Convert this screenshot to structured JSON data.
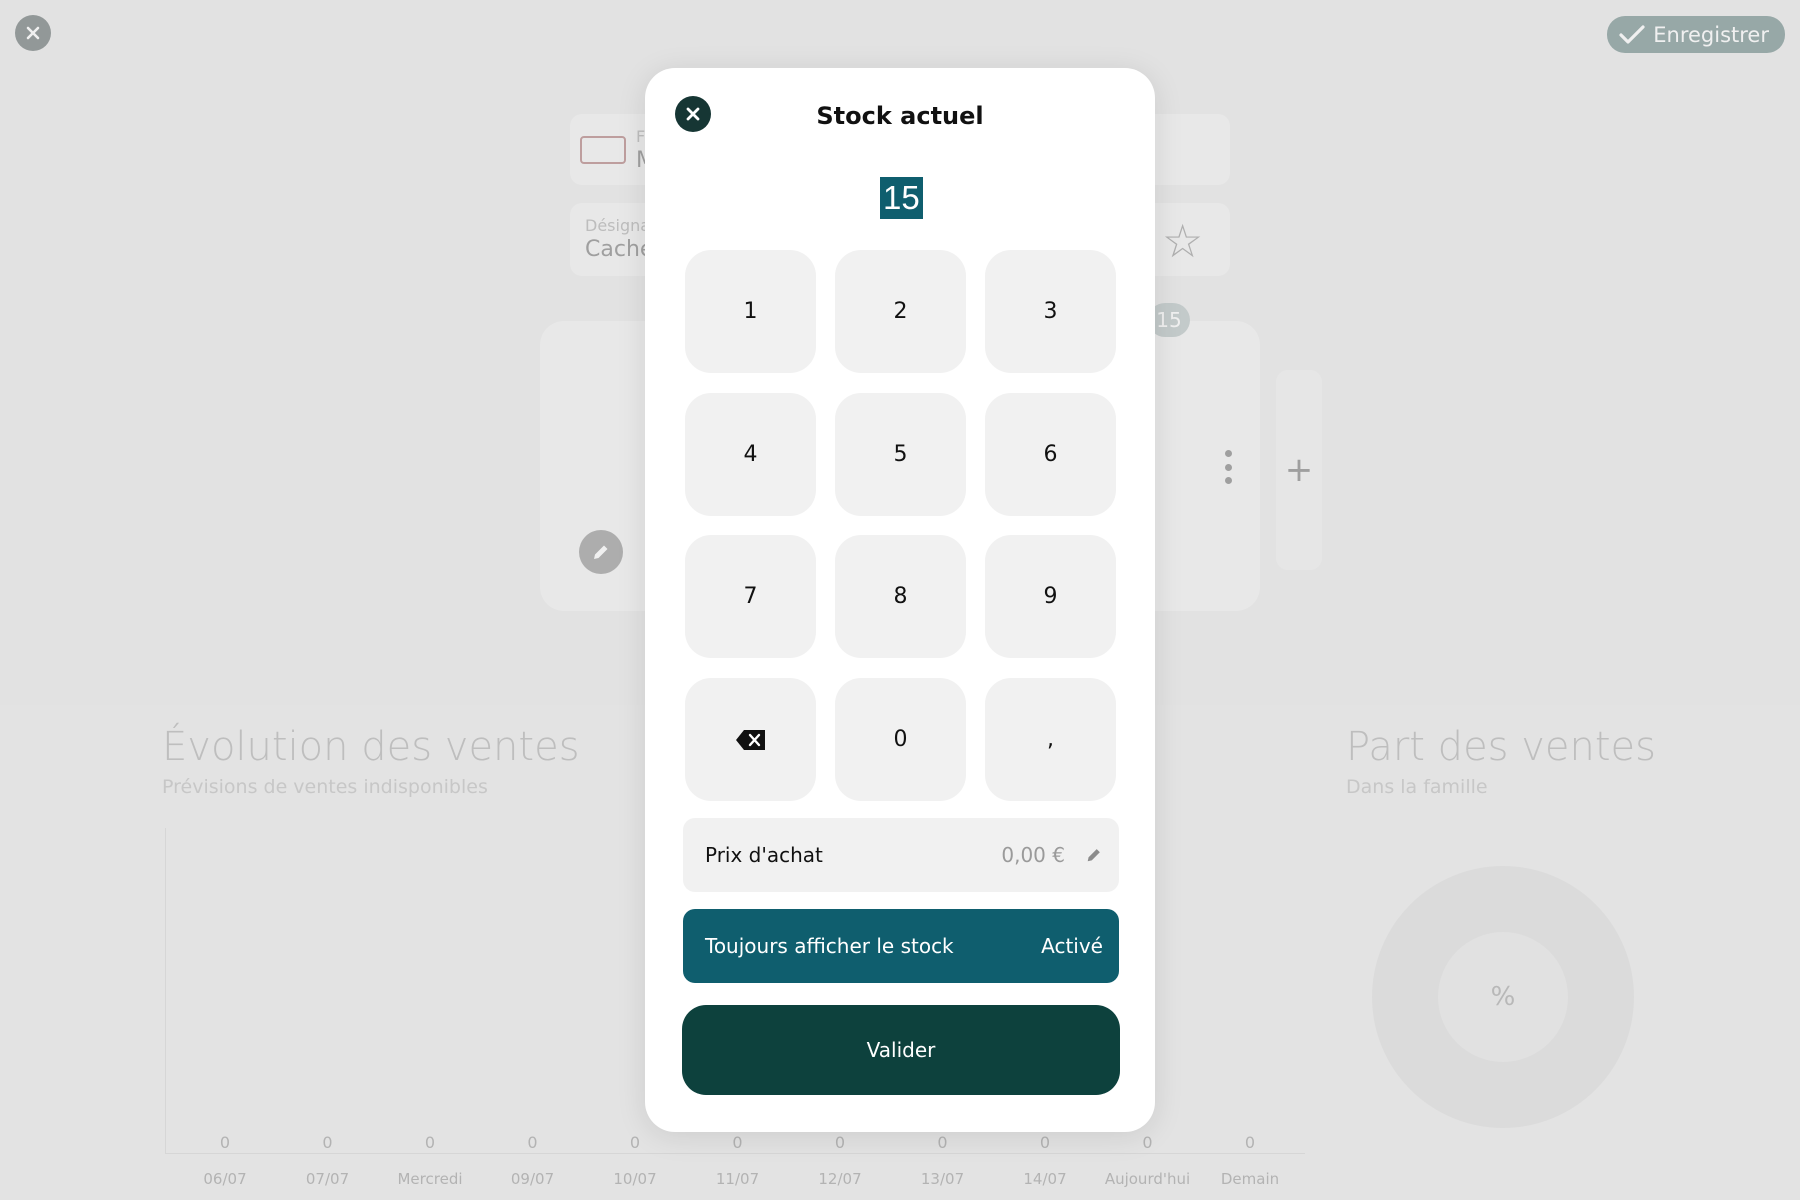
{
  "background": {
    "save_label": "Enregistrer",
    "family_label": "F",
    "family_value": "M",
    "designation_label": "Désigna",
    "designation_value": "Cache",
    "stock_badge": "15",
    "sales_evolution": {
      "title": "Évolution des ventes",
      "subtitle": "Prévisions de ventes indisponibles"
    },
    "sales_share": {
      "title": "Part des ventes",
      "subtitle": "Dans la famille",
      "center_label": "%"
    }
  },
  "chart_data": {
    "type": "bar",
    "title": "Évolution des ventes",
    "categories": [
      "06/07",
      "07/07",
      "Mercredi",
      "09/07",
      "10/07",
      "11/07",
      "12/07",
      "13/07",
      "14/07",
      "Aujourd'hui",
      "Demain"
    ],
    "values": [
      0,
      0,
      0,
      0,
      0,
      0,
      0,
      0,
      0,
      0,
      0
    ]
  },
  "modal": {
    "title": "Stock actuel",
    "display_value": "15",
    "keys": [
      "1",
      "2",
      "3",
      "4",
      "5",
      "6",
      "7",
      "8",
      "9",
      "0",
      ","
    ],
    "price": {
      "label": "Prix d'achat",
      "value": "0,00 €"
    },
    "toggle": {
      "label": "Toujours afficher le stock",
      "state": "Activé"
    },
    "validate_label": "Valider"
  }
}
